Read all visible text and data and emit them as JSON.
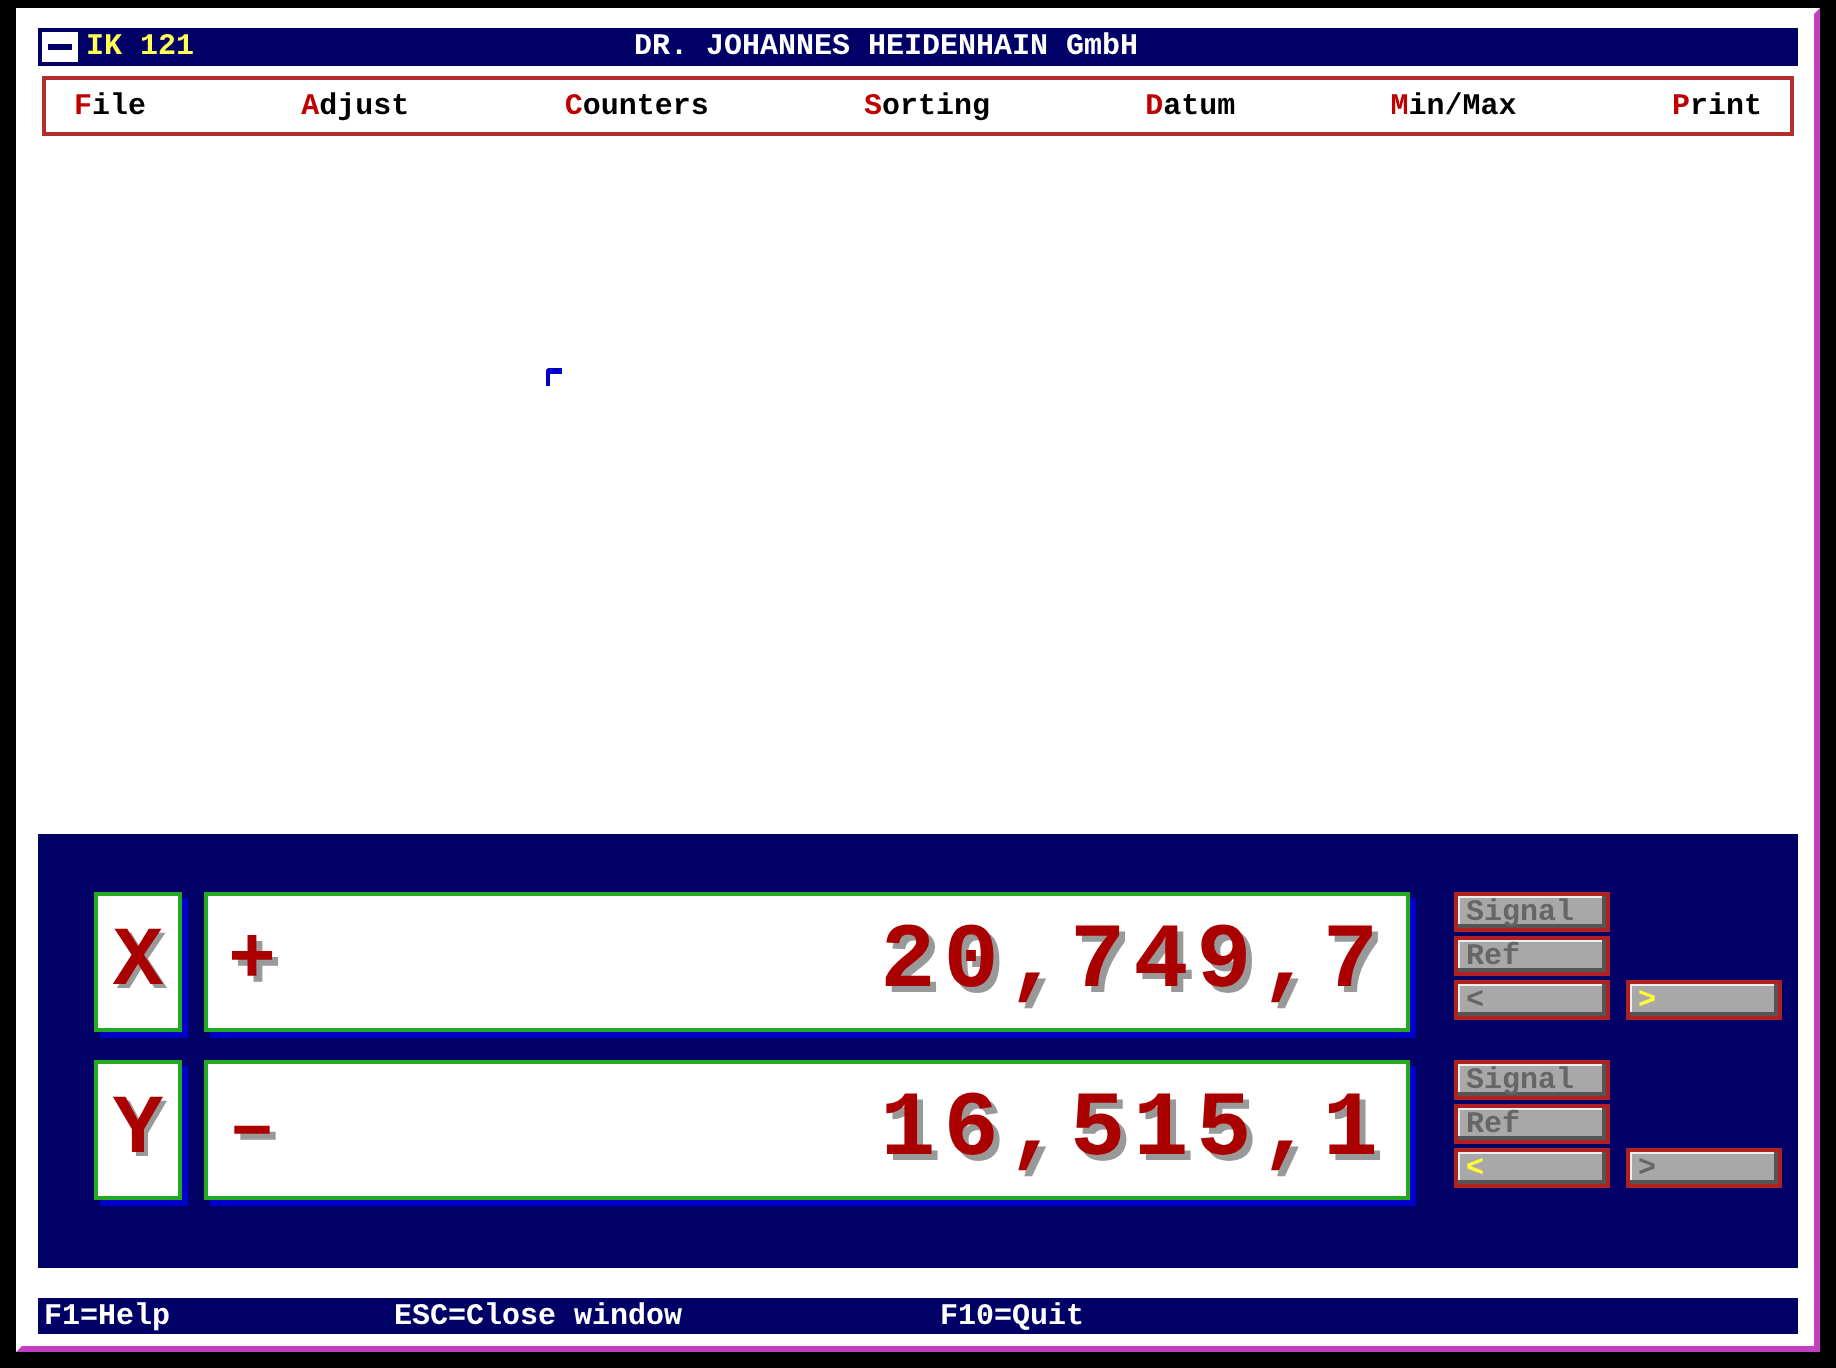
{
  "window": {
    "app_label": "IK 121",
    "title": "DR. JOHANNES HEIDENHAIN GmbH"
  },
  "menu": [
    "File",
    "Adjust",
    "Counters",
    "Sorting",
    "Datum",
    "Min/Max",
    "Print"
  ],
  "axes": [
    {
      "axis": "X",
      "sign": "+",
      "value": "20,749,7",
      "buttons": [
        {
          "label": "Signal"
        },
        {
          "label": "Ref"
        }
      ],
      "directions": [
        {
          "label": "<",
          "selected": false
        },
        {
          "label": ">",
          "selected": true
        }
      ]
    },
    {
      "axis": "Y",
      "sign": "–",
      "value": "16,515,1",
      "buttons": [
        {
          "label": "Signal"
        },
        {
          "label": "Ref"
        }
      ],
      "directions": [
        {
          "label": "<",
          "selected": true
        },
        {
          "label": ">",
          "selected": false
        }
      ]
    }
  ],
  "status_bar": [
    "F1=Help",
    "ESC=Close window",
    "F10=Quit"
  ]
}
